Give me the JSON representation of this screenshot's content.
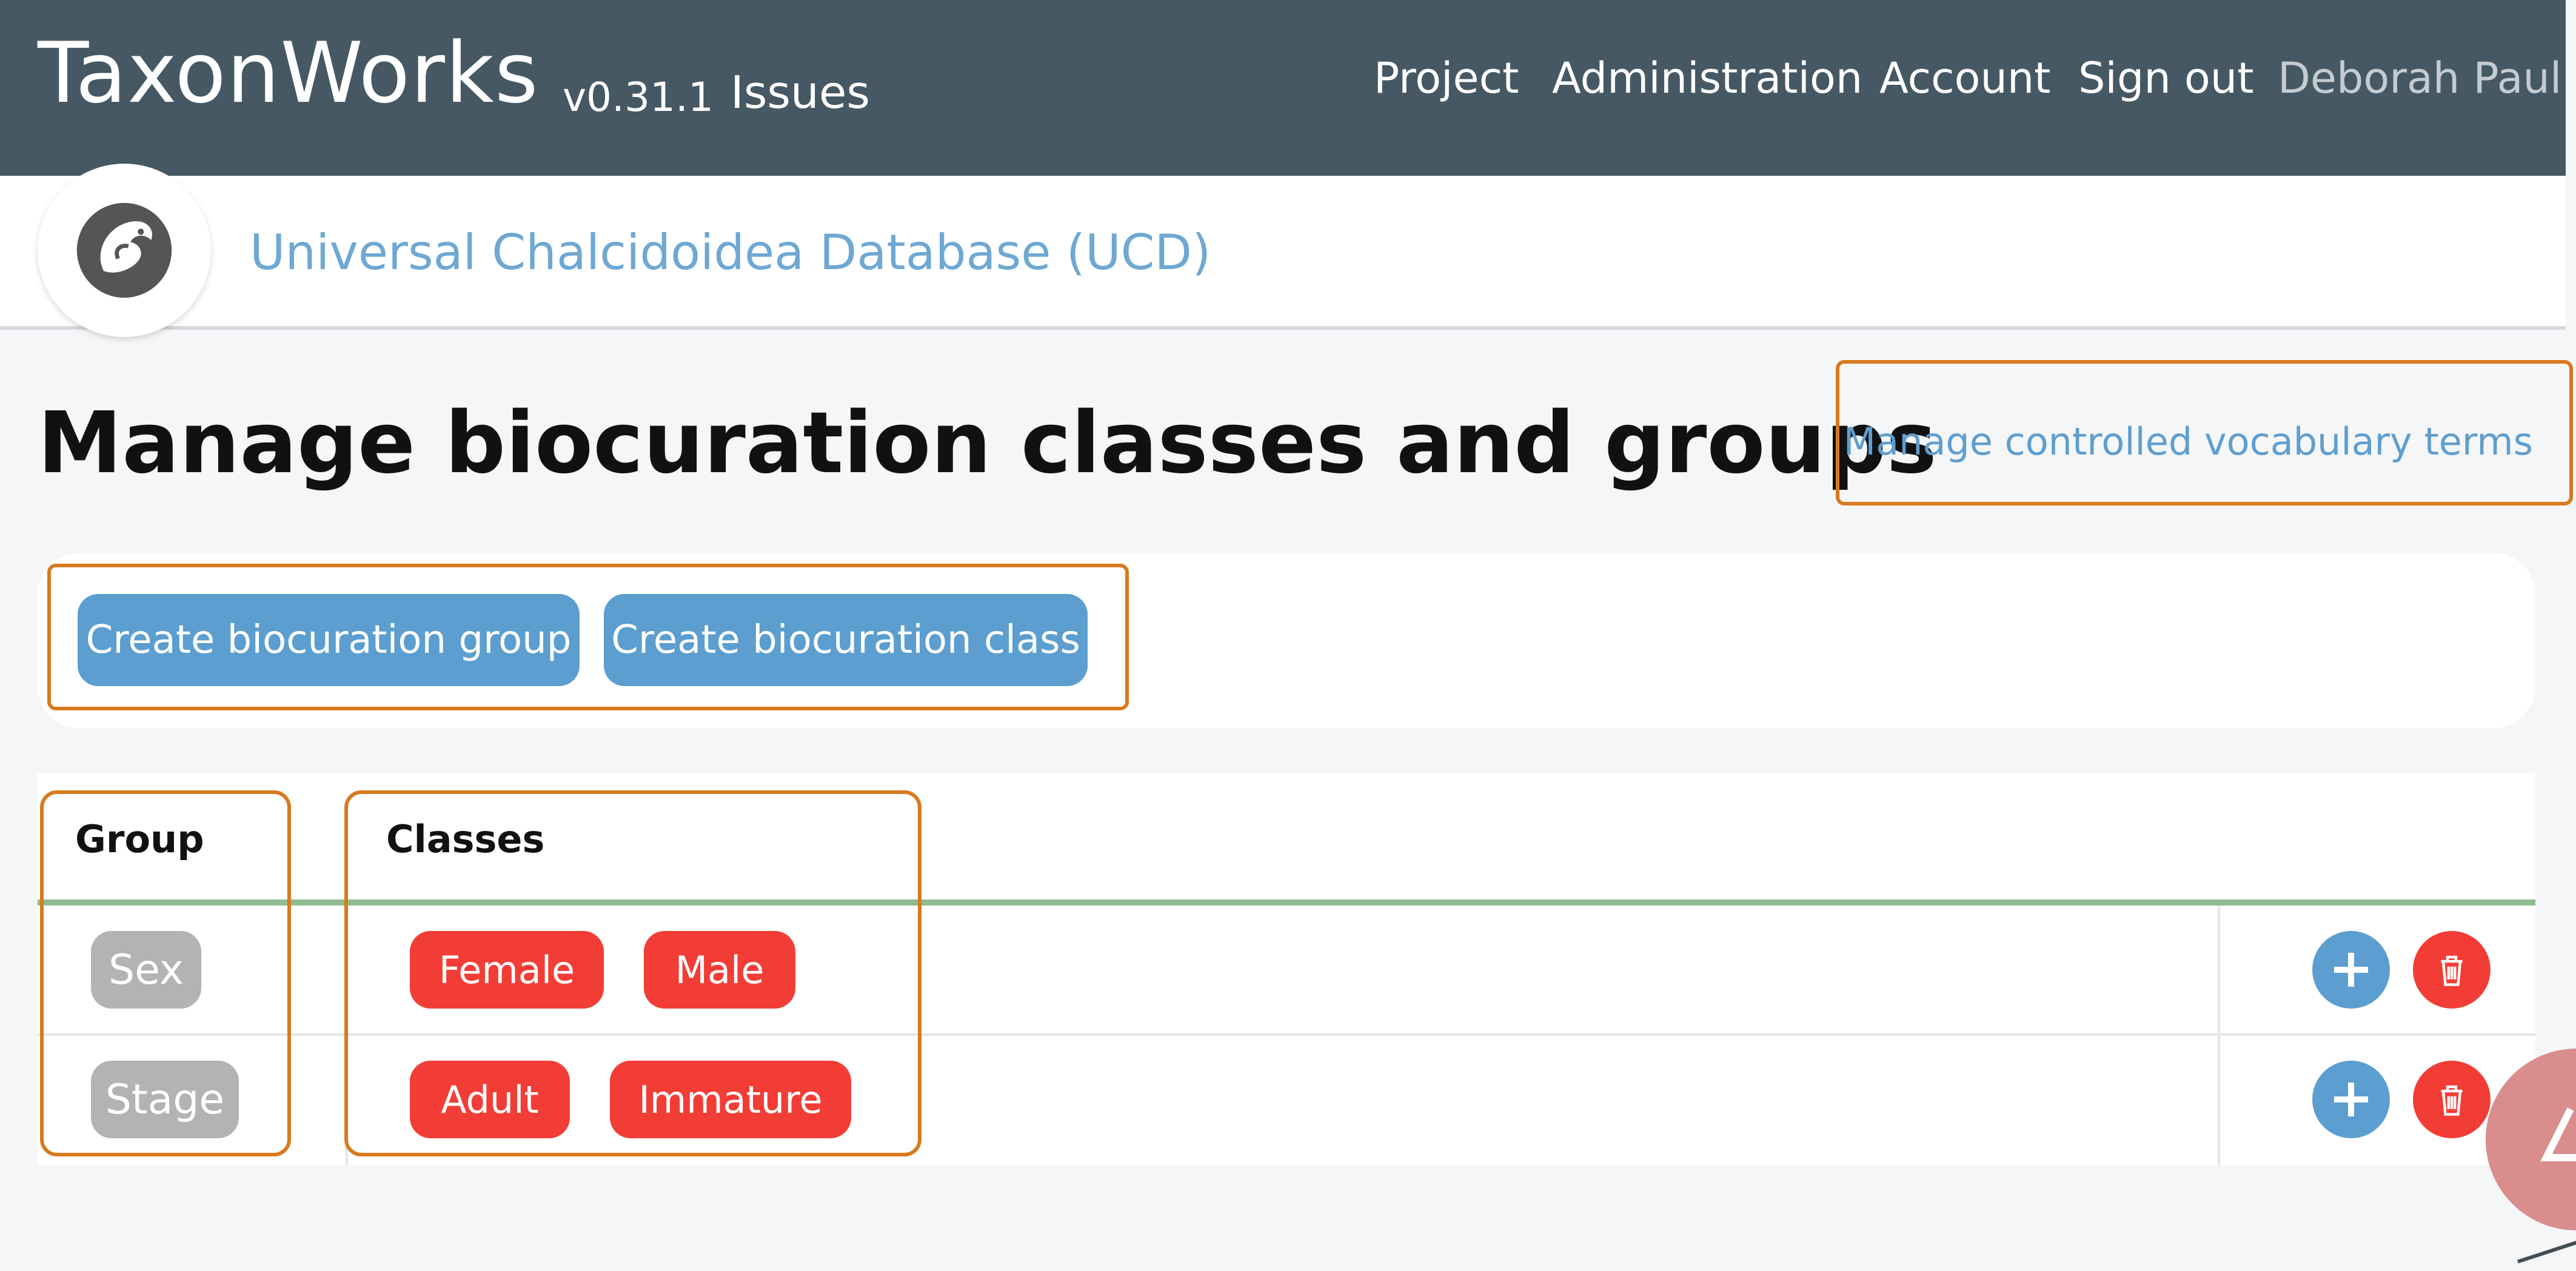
{
  "header": {
    "brand": "TaxonWorks",
    "version": "v0.31.1",
    "issues": "Issues",
    "nav": [
      "Project",
      "Administration",
      "Account",
      "Sign out",
      "Deborah Paul"
    ]
  },
  "project": {
    "name": "Universal Chalcidoidea Database (UCD)"
  },
  "page": {
    "title": "Manage biocuration classes and groups",
    "cv_link": "Manage controlled vocabulary terms"
  },
  "actions": {
    "create_group": "Create biocuration group",
    "create_class": "Create biocuration class"
  },
  "table": {
    "headers": {
      "group": "Group",
      "classes": "Classes"
    },
    "rows": [
      {
        "group": "Sex",
        "classes": [
          "Female",
          "Male"
        ]
      },
      {
        "group": "Stage",
        "classes": [
          "Adult",
          "Immature"
        ]
      }
    ]
  },
  "icons": [
    "dragon-logo-icon",
    "plus-icon",
    "trash-icon"
  ],
  "colors": {
    "topbar": "#465863",
    "accent_blue": "#5b9ecf",
    "danger_red": "#f23d36",
    "outline_orange": "#d77a1e"
  }
}
